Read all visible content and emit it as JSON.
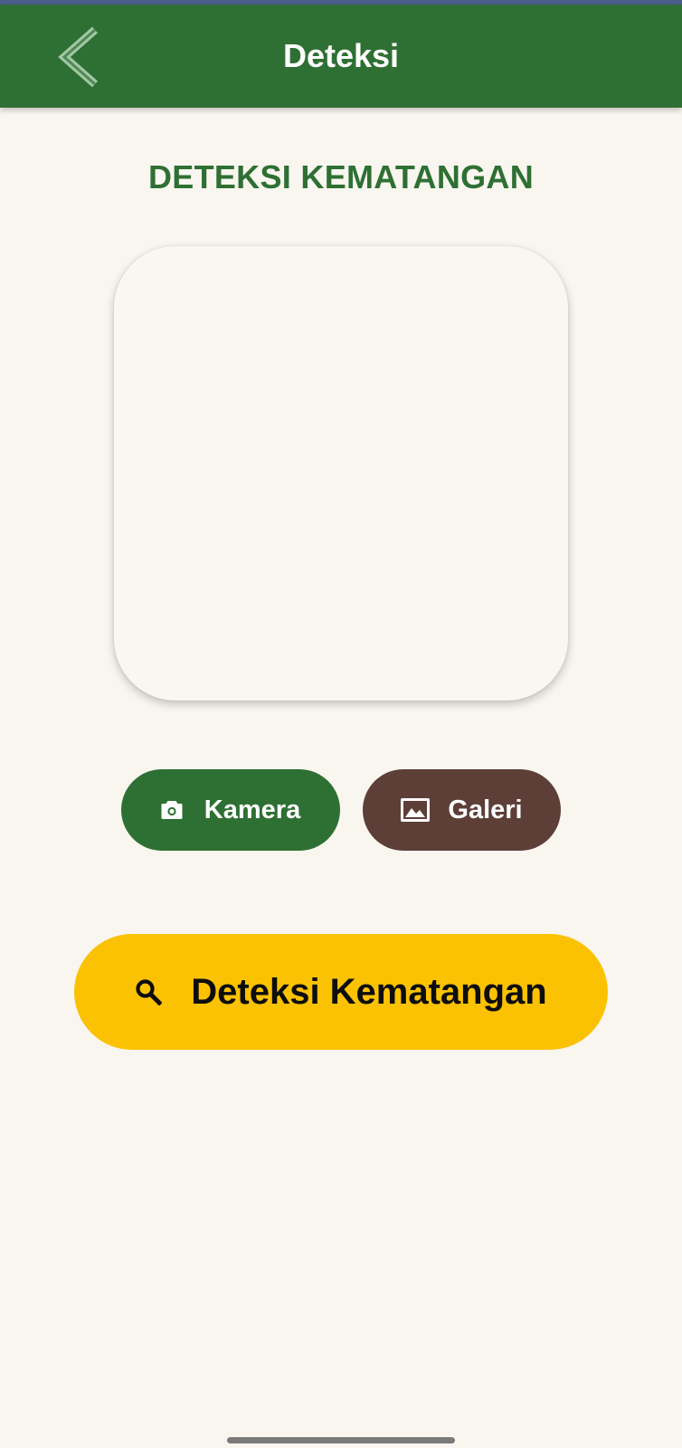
{
  "app_bar": {
    "title": "Deteksi",
    "back_icon": "chevron-left-icon"
  },
  "heading": "DETEKSI KEMATANGAN",
  "actions": {
    "camera": {
      "label": "Kamera",
      "icon": "camera-icon",
      "color": "#2e7033"
    },
    "gallery": {
      "label": "Galeri",
      "icon": "image-icon",
      "color": "#5d3f37"
    }
  },
  "detect": {
    "label": "Deteksi Kematangan",
    "icon": "search-icon",
    "color": "#fbc204"
  },
  "colors": {
    "primary": "#2e7033",
    "background": "#f9f6f0",
    "accent": "#fbc204"
  }
}
